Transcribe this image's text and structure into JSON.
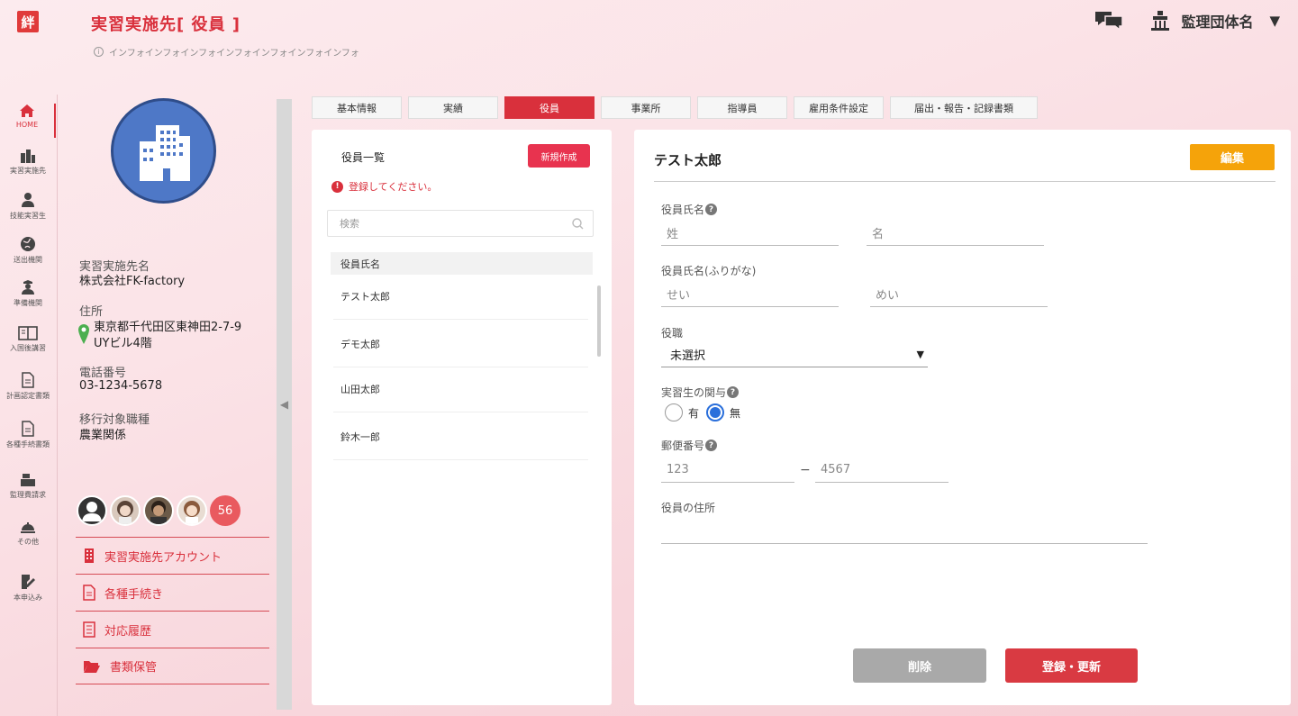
{
  "header": {
    "logo_text": "絆",
    "page_title": "実習実施先[ 役員 ]",
    "info_text": "インフォインフォインフォインフォインフォインフォインフォ",
    "org_name": "監理団体名",
    "caret": "▼"
  },
  "nav": [
    {
      "label": "HOME",
      "icon": "home-icon"
    },
    {
      "label": "実習実施先",
      "icon": "building-icon"
    },
    {
      "label": "技能実習生",
      "icon": "person-icon"
    },
    {
      "label": "送出機関",
      "icon": "globe-icon"
    },
    {
      "label": "準備機関",
      "icon": "officer-icon"
    },
    {
      "label": "入国後講習",
      "icon": "book-icon"
    },
    {
      "label": "計画認定書類",
      "icon": "document-icon"
    },
    {
      "label": "各種手続書類",
      "icon": "document-icon"
    },
    {
      "label": "監理費請求",
      "icon": "register-icon"
    },
    {
      "label": "その他",
      "icon": "bell-icon"
    },
    {
      "label": "本申込み",
      "icon": "sign-icon"
    }
  ],
  "profile": {
    "name_label": "実習実施先名",
    "name_value": "株式会社FK-factory",
    "address_label": "住所",
    "address_line1": "東京都千代田区東神田2-7-9",
    "address_line2": "UYビル4階",
    "phone_label": "電話番号",
    "phone_value": "03-1234-5678",
    "job_label": "移行対象職種",
    "job_value": "農業関係",
    "member_count": "56"
  },
  "side_menu": [
    {
      "label": "実習実施先アカウント",
      "icon": "building-icon"
    },
    {
      "label": "各種手続き",
      "icon": "document-icon"
    },
    {
      "label": "対応履歴",
      "icon": "list-icon"
    },
    {
      "label": "書類保管",
      "icon": "folder-icon"
    }
  ],
  "tabs": [
    {
      "label": "基本情報",
      "active": false
    },
    {
      "label": "実績",
      "active": false
    },
    {
      "label": "役員",
      "active": true
    },
    {
      "label": "事業所",
      "active": false
    },
    {
      "label": "指導員",
      "active": false
    },
    {
      "label": "雇用条件設定",
      "active": false
    },
    {
      "label": "届出・報告・記録書類",
      "active": false
    }
  ],
  "list_panel": {
    "title": "役員一覧",
    "new_button": "新規作成",
    "warning": "登録してください。",
    "search_placeholder": "検索",
    "column_header": "役員氏名",
    "rows": [
      "テスト太郎",
      "デモ太郎",
      "山田太郎",
      "鈴木一郎"
    ]
  },
  "detail": {
    "title": "テスト太郎",
    "edit_button": "編集",
    "name_label": "役員氏名",
    "last_name_placeholder": "姓",
    "first_name_placeholder": "名",
    "kana_label": "役員氏名(ふりがな)",
    "last_kana_placeholder": "せい",
    "first_kana_placeholder": "めい",
    "position_label": "役職",
    "position_value": "未選択",
    "involvement_label": "実習生の関与",
    "radio_yes": "有",
    "radio_no": "無",
    "radio_selected": "無",
    "postal_label": "郵便番号",
    "postal_1": "123",
    "postal_dash": "−",
    "postal_2": "4567",
    "address_label": "役員の住所",
    "delete_button": "削除",
    "save_button": "登録・更新"
  },
  "colors": {
    "accent": "#d9303c",
    "edit": "#f5a30a",
    "avatar_bg": "#4e78c7",
    "radio": "#2a6fdb"
  }
}
